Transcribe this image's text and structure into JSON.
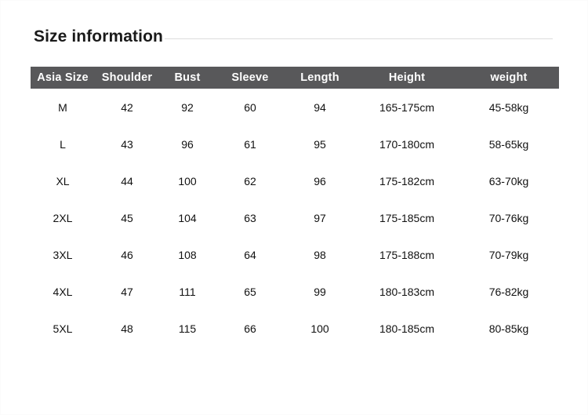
{
  "header": {
    "title": "Size information"
  },
  "colors": {
    "header_bar": "#58585a",
    "header_text": "#ffffff",
    "body_text": "#111111",
    "rule": "#dcdcdc",
    "background": "#ffffff"
  },
  "table": {
    "columns": [
      {
        "key": "asia_size",
        "label": "Asia Size"
      },
      {
        "key": "shoulder",
        "label": "Shoulder"
      },
      {
        "key": "bust",
        "label": "Bust"
      },
      {
        "key": "sleeve",
        "label": "Sleeve"
      },
      {
        "key": "length",
        "label": "Length"
      },
      {
        "key": "height",
        "label": "Height"
      },
      {
        "key": "weight",
        "label": "weight"
      }
    ],
    "rows": [
      {
        "asia_size": "M",
        "shoulder": "42",
        "bust": "92",
        "sleeve": "60",
        "length": "94",
        "height": "165-175cm",
        "weight": "45-58kg"
      },
      {
        "asia_size": "L",
        "shoulder": "43",
        "bust": "96",
        "sleeve": "61",
        "length": "95",
        "height": "170-180cm",
        "weight": "58-65kg"
      },
      {
        "asia_size": "XL",
        "shoulder": "44",
        "bust": "100",
        "sleeve": "62",
        "length": "96",
        "height": "175-182cm",
        "weight": "63-70kg"
      },
      {
        "asia_size": "2XL",
        "shoulder": "45",
        "bust": "104",
        "sleeve": "63",
        "length": "97",
        "height": "175-185cm",
        "weight": "70-76kg"
      },
      {
        "asia_size": "3XL",
        "shoulder": "46",
        "bust": "108",
        "sleeve": "64",
        "length": "98",
        "height": "175-188cm",
        "weight": "70-79kg"
      },
      {
        "asia_size": "4XL",
        "shoulder": "47",
        "bust": "111",
        "sleeve": "65",
        "length": "99",
        "height": "180-183cm",
        "weight": "76-82kg"
      },
      {
        "asia_size": "5XL",
        "shoulder": "48",
        "bust": "115",
        "sleeve": "66",
        "length": "100",
        "height": "180-185cm",
        "weight": "80-85kg"
      }
    ]
  }
}
